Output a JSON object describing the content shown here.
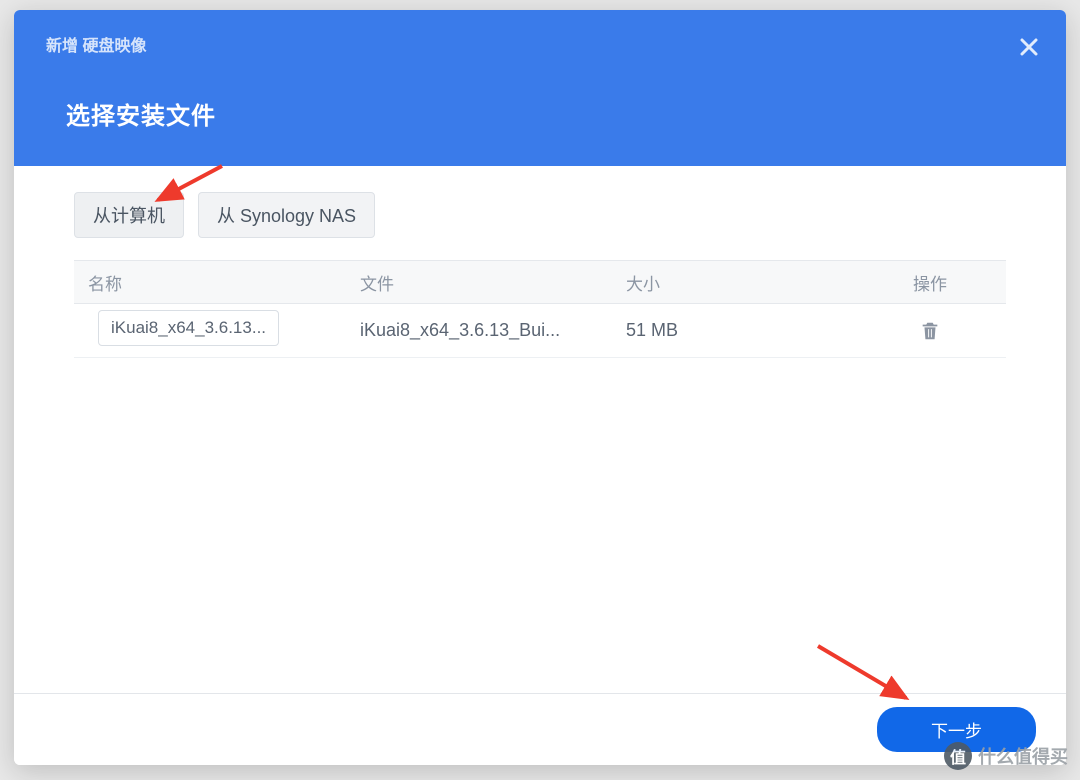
{
  "colors": {
    "primary": "#3a7bea",
    "primary_btn": "#1168e8",
    "arrow": "#ee3a2c"
  },
  "header": {
    "breadcrumb": "新增 硬盘映像",
    "title": "选择安装文件",
    "close_icon": "close-icon"
  },
  "tabs": [
    {
      "label": "从计算机",
      "active": true
    },
    {
      "label": "从 Synology NAS",
      "active": false
    }
  ],
  "table": {
    "headers": {
      "name": "名称",
      "file": "文件",
      "size": "大小",
      "action": "操作"
    },
    "rows": [
      {
        "name": "iKuai8_x64_3.6.13...",
        "file": "iKuai8_x64_3.6.13_Bui...",
        "size": "51 MB"
      }
    ]
  },
  "footer": {
    "next_label": "下一步"
  },
  "watermark": {
    "badge": "值",
    "text": "什么值得买"
  }
}
